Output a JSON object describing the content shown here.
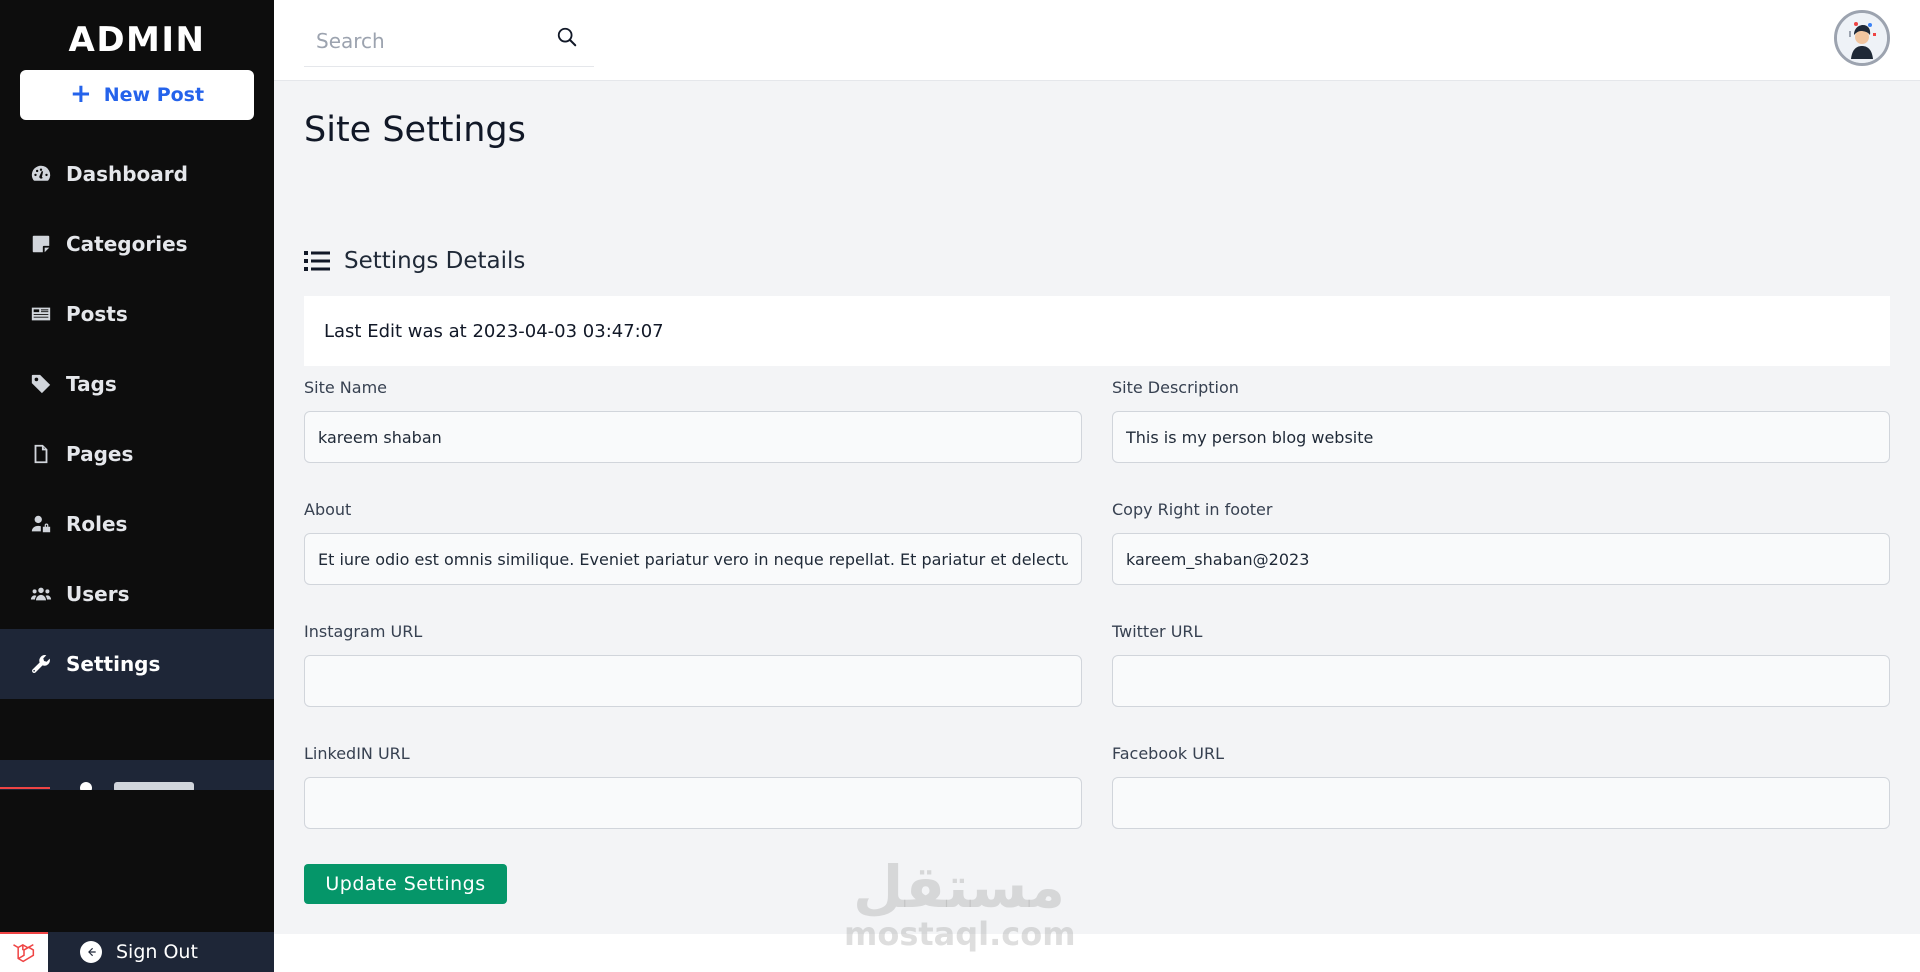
{
  "sidebar": {
    "brand": "ADMIN",
    "new_post_label": "New Post",
    "items": [
      {
        "label": "Dashboard",
        "icon": "dashboard-gauge-icon"
      },
      {
        "label": "Categories",
        "icon": "sticky-note-icon"
      },
      {
        "label": "Posts",
        "icon": "newspaper-icon"
      },
      {
        "label": "Tags",
        "icon": "tag-icon"
      },
      {
        "label": "Pages",
        "icon": "file-icon"
      },
      {
        "label": "Roles",
        "icon": "user-lock-icon"
      },
      {
        "label": "Users",
        "icon": "users-icon"
      },
      {
        "label": "Settings",
        "icon": "wrench-icon",
        "active": true
      }
    ],
    "sign_out_label": "Sign Out"
  },
  "topbar": {
    "search_placeholder": "Search"
  },
  "page": {
    "title": "Site Settings",
    "section_title": "Settings Details",
    "last_edit": "Last Edit was at 2023-04-03 03:47:07"
  },
  "form": {
    "site_name": {
      "label": "Site Name",
      "value": "kareem shaban"
    },
    "site_description": {
      "label": "Site Description",
      "value": "This is my person blog website"
    },
    "about": {
      "label": "About",
      "value": "Et iure odio est omnis similique. Eveniet pariatur vero in neque repellat. Et pariatur et delectus"
    },
    "copyright": {
      "label": "Copy Right in footer",
      "value": "kareem_shaban@2023"
    },
    "instagram": {
      "label": "Instagram URL",
      "value": ""
    },
    "twitter": {
      "label": "Twitter URL",
      "value": ""
    },
    "linkedin": {
      "label": "LinkedIN URL",
      "value": ""
    },
    "facebook": {
      "label": "Facebook URL",
      "value": ""
    },
    "submit_label": "Update Settings"
  },
  "watermark": {
    "arabic": "مستقل",
    "latin": "mostaql.com"
  },
  "colors": {
    "sidebar_bg": "#0d0d0d",
    "active_item_bg": "#1e2637",
    "accent_blue": "#2563eb",
    "button_green": "#059669",
    "content_bg": "#f3f4f6"
  }
}
